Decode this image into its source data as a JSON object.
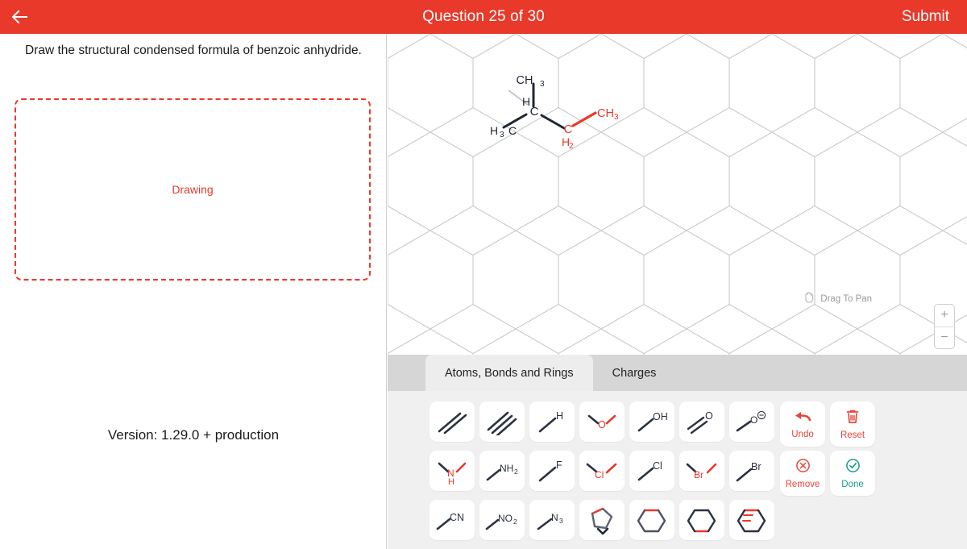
{
  "header": {
    "back_icon": "arrow-left-icon",
    "title": "Question 25 of 30",
    "submit_label": "Submit",
    "bg_color": "#e8392a"
  },
  "left_panel": {
    "question": "Draw the structural condensed formula of benzoic anhydride.",
    "drawing_placeholder": "Drawing",
    "drawing_border_color": "#e8392a",
    "version": "Version: 1.29.0 +  production"
  },
  "canvas": {
    "grid": "hexagonal",
    "grid_color": "#c9c9c9",
    "pan_hint": "Drag To Pan",
    "pan_icon": "hand-icon",
    "zoom_in_label": "+",
    "zoom_out_label": "−",
    "molecule": {
      "labels": [
        {
          "text": "CH₃",
          "color": "#1f2733"
        },
        {
          "text": "H",
          "color": "#1f2733"
        },
        {
          "text": "C",
          "color": "#1f2733"
        },
        {
          "text": "H₃C",
          "color": "#1f2733"
        },
        {
          "text": "C",
          "color": "#e8392a"
        },
        {
          "text": "H₂",
          "color": "#e8392a"
        },
        {
          "text": "CH₃",
          "color": "#e8392a"
        }
      ]
    }
  },
  "tabs": [
    {
      "label": "Atoms, Bonds and Rings",
      "active": true
    },
    {
      "label": "Charges",
      "active": false
    }
  ],
  "palette": {
    "tools": [
      {
        "name": "double-bond-tool",
        "label": ""
      },
      {
        "name": "triple-bond-tool",
        "label": ""
      },
      {
        "name": "hydrogen-tool",
        "label": "H"
      },
      {
        "name": "ether-oxygen-tool",
        "label": "O"
      },
      {
        "name": "hydroxyl-tool",
        "label": "OH"
      },
      {
        "name": "carbonyl-oxygen-tool",
        "label": "O"
      },
      {
        "name": "oxide-anion-tool",
        "label": "O"
      },
      {
        "name": "amine-nh-tool",
        "label": "N"
      },
      {
        "name": "amino-tool",
        "label": "NH₂"
      },
      {
        "name": "fluorine-tool",
        "label": "F"
      },
      {
        "name": "chlorine-bridge-tool",
        "label": "Cl"
      },
      {
        "name": "chlorine-tool",
        "label": "Cl"
      },
      {
        "name": "bromine-bridge-tool",
        "label": "Br"
      },
      {
        "name": "bromine-tool",
        "label": "Br"
      },
      {
        "name": "cyano-tool",
        "label": "CN"
      },
      {
        "name": "nitro-tool",
        "label": "NO₂"
      },
      {
        "name": "azide-tool",
        "label": "N₃"
      },
      {
        "name": "cyclopentane-ring-tool",
        "label": ""
      },
      {
        "name": "cyclohexane-ring-tool",
        "label": ""
      },
      {
        "name": "cyclohexane-alt-ring-tool",
        "label": ""
      },
      {
        "name": "benzene-ring-tool",
        "label": ""
      }
    ],
    "actions": [
      {
        "name": "undo-button",
        "label": "Undo",
        "icon": "undo-arrow-icon",
        "color": "#e8453a"
      },
      {
        "name": "reset-button",
        "label": "Reset",
        "icon": "trash-icon",
        "color": "#e8453a"
      },
      {
        "name": "remove-button",
        "label": "Remove",
        "icon": "x-circle-icon",
        "color": "#e8453a"
      },
      {
        "name": "done-button",
        "label": "Done",
        "icon": "check-circle-icon",
        "color": "#169c8c"
      }
    ]
  }
}
